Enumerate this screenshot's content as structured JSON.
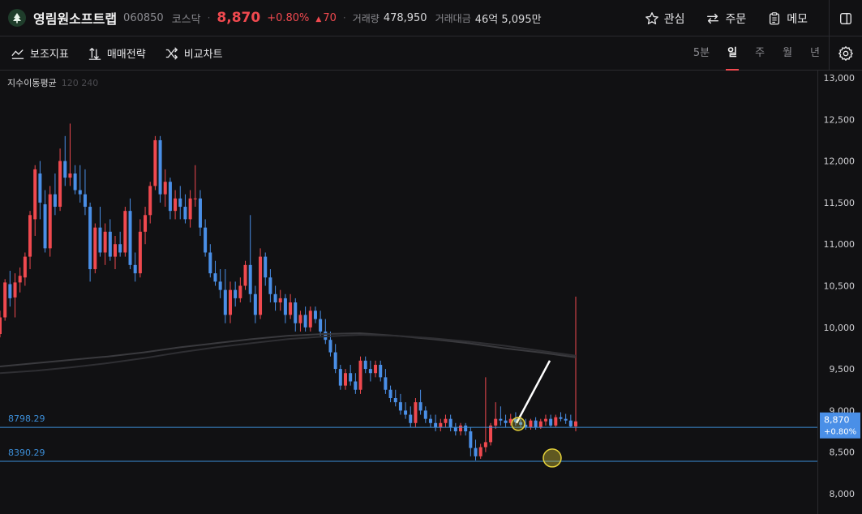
{
  "header": {
    "stock_name": "영림원소프트랩",
    "code": "060850",
    "market": "코스닥",
    "price": "8,870",
    "change_pct": "+0.80%",
    "change_abs": "70",
    "volume_label": "거래량",
    "volume_value": "478,950",
    "amount_label": "거래대금",
    "amount_value": "46억 5,095만",
    "watch_label": "관심",
    "order_label": "주문",
    "memo_label": "메모"
  },
  "toolbar": {
    "indicators_label": "보조지표",
    "strategy_label": "매매전략",
    "compare_label": "비교차트",
    "periods": [
      "5분",
      "일",
      "주",
      "월",
      "년"
    ],
    "active_period": "일"
  },
  "indicator": {
    "name": "지수이동평균",
    "params": "120 240"
  },
  "colors": {
    "up": "#f0494f",
    "down": "#4a8fe7",
    "background": "#111113",
    "level_line": "#3c8ed8",
    "price_tag": "#4a8fe7"
  },
  "chart_data": {
    "type": "candlestick",
    "y_ticks": [
      "13,000",
      "12,500",
      "12,000",
      "11,500",
      "11,000",
      "10,500",
      "10,000",
      "9,500",
      "9,000",
      "8,500",
      "8,000"
    ],
    "ylim": [
      8000,
      13000
    ],
    "current_price_tag": {
      "price": "8,870",
      "change": "+0.80%"
    },
    "levels": [
      {
        "label": "8798.29",
        "value": 8798.29
      },
      {
        "label": "8390.29",
        "value": 8390.29
      }
    ],
    "candles": [
      [
        9920,
        10200,
        9880,
        10120
      ],
      [
        10120,
        10580,
        10080,
        10540
      ],
      [
        10520,
        10680,
        10250,
        10350
      ],
      [
        10360,
        10650,
        10120,
        10540
      ],
      [
        10540,
        10720,
        10420,
        10620
      ],
      [
        10600,
        10900,
        10500,
        10850
      ],
      [
        10850,
        11400,
        10700,
        11350
      ],
      [
        11300,
        11950,
        11100,
        11900
      ],
      [
        11850,
        12000,
        11300,
        11500
      ],
      [
        11480,
        11650,
        10900,
        10950
      ],
      [
        10950,
        11700,
        10850,
        11600
      ],
      [
        11600,
        11850,
        11350,
        11450
      ],
      [
        11450,
        12150,
        11400,
        12000
      ],
      [
        12000,
        12300,
        11700,
        11800
      ],
      [
        11800,
        12450,
        11700,
        11850
      ],
      [
        11850,
        11950,
        11600,
        11650
      ],
      [
        11650,
        11950,
        11500,
        11600
      ],
      [
        11600,
        11900,
        11350,
        11450
      ],
      [
        11450,
        11500,
        10550,
        10700
      ],
      [
        10700,
        11250,
        10650,
        11200
      ],
      [
        11200,
        11450,
        10850,
        10900
      ],
      [
        10900,
        11250,
        10750,
        11150
      ],
      [
        11150,
        11300,
        10800,
        10850
      ],
      [
        10850,
        11100,
        10700,
        11000
      ],
      [
        11000,
        11150,
        10850,
        10900
      ],
      [
        10900,
        11450,
        10850,
        11400
      ],
      [
        11400,
        11550,
        10700,
        10750
      ],
      [
        10750,
        10900,
        10550,
        10650
      ],
      [
        10650,
        11300,
        10600,
        11150
      ],
      [
        11150,
        11450,
        11000,
        11350
      ],
      [
        11350,
        11750,
        11250,
        11700
      ],
      [
        11700,
        12300,
        11650,
        12250
      ],
      [
        12250,
        12300,
        11500,
        11600
      ],
      [
        11600,
        11900,
        11450,
        11750
      ],
      [
        11750,
        11800,
        11300,
        11400
      ],
      [
        11400,
        11650,
        11300,
        11550
      ],
      [
        11550,
        11700,
        11300,
        11450
      ],
      [
        11450,
        11600,
        11250,
        11300
      ],
      [
        11300,
        11650,
        11200,
        11550
      ],
      [
        11550,
        11950,
        11450,
        11550
      ],
      [
        11550,
        11650,
        11100,
        11200
      ],
      [
        11200,
        11300,
        10850,
        10900
      ],
      [
        10900,
        11000,
        10600,
        10650
      ],
      [
        10650,
        10800,
        10500,
        10550
      ],
      [
        10550,
        10700,
        10350,
        10450
      ],
      [
        10450,
        10700,
        10050,
        10150
      ],
      [
        10150,
        10550,
        10050,
        10450
      ],
      [
        10450,
        10550,
        10250,
        10350
      ],
      [
        10350,
        10600,
        10300,
        10500
      ],
      [
        10500,
        10800,
        10450,
        10750
      ],
      [
        10750,
        11350,
        10300,
        10400
      ],
      [
        10400,
        10500,
        10050,
        10150
      ],
      [
        10150,
        10950,
        10100,
        10850
      ],
      [
        10850,
        10900,
        10500,
        10600
      ],
      [
        10600,
        10700,
        10300,
        10400
      ],
      [
        10400,
        10500,
        10200,
        10300
      ],
      [
        10300,
        10450,
        10200,
        10350
      ],
      [
        10350,
        10400,
        10050,
        10150
      ],
      [
        10150,
        10400,
        10100,
        10300
      ],
      [
        10300,
        10350,
        9950,
        10050
      ],
      [
        10050,
        10200,
        9950,
        10150
      ],
      [
        10150,
        10250,
        9950,
        10000
      ],
      [
        10000,
        10250,
        9950,
        10200
      ],
      [
        10200,
        10250,
        10050,
        10100
      ],
      [
        10100,
        10200,
        9900,
        9950
      ],
      [
        9950,
        10100,
        9800,
        9850
      ],
      [
        9850,
        9950,
        9650,
        9700
      ],
      [
        9700,
        9800,
        9450,
        9500
      ],
      [
        9500,
        9550,
        9250,
        9300
      ],
      [
        9300,
        9500,
        9250,
        9450
      ],
      [
        9450,
        9550,
        9300,
        9350
      ],
      [
        9350,
        9450,
        9200,
        9250
      ],
      [
        9250,
        9650,
        9200,
        9600
      ],
      [
        9600,
        9650,
        9450,
        9500
      ],
      [
        9500,
        9600,
        9350,
        9450
      ],
      [
        9450,
        9600,
        9400,
        9550
      ],
      [
        9550,
        9600,
        9350,
        9400
      ],
      [
        9400,
        9500,
        9200,
        9250
      ],
      [
        9250,
        9300,
        9100,
        9150
      ],
      [
        9150,
        9250,
        9050,
        9100
      ],
      [
        9100,
        9200,
        8950,
        9000
      ],
      [
        9000,
        9100,
        8900,
        8950
      ],
      [
        8950,
        9050,
        8800,
        8850
      ],
      [
        8850,
        9150,
        8800,
        9100
      ],
      [
        9100,
        9250,
        8950,
        9000
      ],
      [
        9000,
        9050,
        8850,
        8900
      ],
      [
        8900,
        8950,
        8800,
        8850
      ],
      [
        8850,
        8950,
        8750,
        8800
      ],
      [
        8800,
        8900,
        8750,
        8850
      ],
      [
        8850,
        8950,
        8800,
        8900
      ],
      [
        8900,
        8950,
        8750,
        8800
      ],
      [
        8800,
        8850,
        8700,
        8750
      ],
      [
        8750,
        8850,
        8700,
        8820
      ],
      [
        8820,
        8850,
        8700,
        8750
      ],
      [
        8750,
        8800,
        8450,
        8550
      ],
      [
        8550,
        8650,
        8400,
        8450
      ],
      [
        8450,
        8600,
        8420,
        8560
      ],
      [
        8560,
        9400,
        8500,
        8620
      ],
      [
        8620,
        8850,
        8580,
        8820
      ],
      [
        8820,
        9100,
        8780,
        8900
      ],
      [
        8900,
        9050,
        8820,
        8880
      ],
      [
        8880,
        8950,
        8800,
        8850
      ],
      [
        8850,
        8960,
        8820,
        8900
      ],
      [
        8900,
        8980,
        8820,
        8860
      ],
      [
        8860,
        8920,
        8800,
        8830
      ],
      [
        8830,
        8900,
        8770,
        8800
      ],
      [
        8800,
        8900,
        8770,
        8880
      ],
      [
        8880,
        8920,
        8770,
        8800
      ],
      [
        8800,
        8900,
        8780,
        8870
      ],
      [
        8870,
        8950,
        8820,
        8900
      ],
      [
        8900,
        8950,
        8800,
        8820
      ],
      [
        8820,
        8950,
        8800,
        8920
      ],
      [
        8920,
        8980,
        8870,
        8900
      ],
      [
        8900,
        8960,
        8840,
        8880
      ],
      [
        8880,
        8950,
        8800,
        8810
      ],
      [
        8810,
        10370,
        8750,
        8870
      ]
    ],
    "ema_series": [
      {
        "name": "120",
        "values": [
          9530,
          9570,
          9610,
          9650,
          9700,
          9760,
          9810,
          9860,
          9900,
          9920,
          9930,
          9900,
          9860,
          9810,
          9750,
          9700,
          9640
        ]
      },
      {
        "name": "240",
        "values": [
          9450,
          9480,
          9520,
          9570,
          9630,
          9700,
          9760,
          9810,
          9860,
          9890,
          9910,
          9900,
          9870,
          9830,
          9780,
          9720,
          9660
        ]
      }
    ]
  }
}
